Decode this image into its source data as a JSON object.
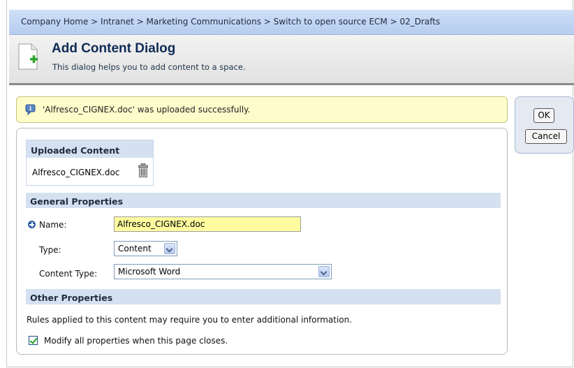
{
  "breadcrumb": "Company Home > Intranet > Marketing Communications > Switch to open source ECM > 02_Drafts",
  "dialog": {
    "title": "Add Content Dialog",
    "description": "This dialog helps you to add content to a space."
  },
  "info_message": "'Alfresco_CIGNEX.doc' was uploaded successfully.",
  "buttons": {
    "ok": "OK",
    "cancel": "Cancel"
  },
  "uploaded": {
    "heading": "Uploaded Content",
    "file_name": "Alfresco_CIGNEX.doc"
  },
  "general_properties": {
    "heading": "General Properties",
    "name_label": "Name:",
    "name_value": "Alfresco_CIGNEX.doc",
    "type_label": "Type:",
    "type_value": "Content",
    "content_type_label": "Content Type:",
    "content_type_value": "Microsoft Word"
  },
  "other_properties": {
    "heading": "Other Properties",
    "rules_text": "Rules applied to this content may require you to enter additional information.",
    "modify_label": "Modify all properties when this page closes.",
    "modify_checked": true
  },
  "colors": {
    "breadcrumb_bg": "#c3d6f3",
    "section_bg": "#d5e1f1",
    "info_bg": "#fefccb",
    "name_input_bg": "#fefc9f",
    "title_color": "#0f2b57"
  }
}
